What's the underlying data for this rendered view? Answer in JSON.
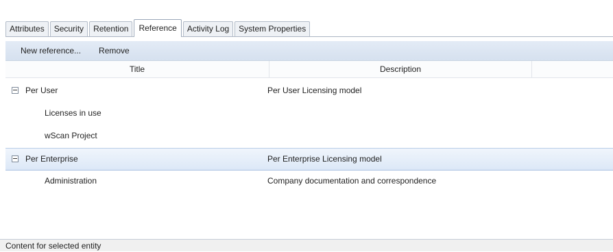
{
  "tabs": [
    {
      "label": "Attributes",
      "active": false
    },
    {
      "label": "Security",
      "active": false
    },
    {
      "label": "Retention",
      "active": false
    },
    {
      "label": "Reference",
      "active": true
    },
    {
      "label": "Activity Log",
      "active": false
    },
    {
      "label": "System Properties",
      "active": false
    }
  ],
  "toolbar": {
    "new_reference_label": "New reference...",
    "remove_label": "Remove"
  },
  "columns": {
    "title": "Title",
    "description": "Description"
  },
  "rows": [
    {
      "title": "Per User",
      "description": "Per User Licensing model",
      "level": 0,
      "expanded": true,
      "selected": false
    },
    {
      "title": "Licenses in use",
      "description": "",
      "level": 1,
      "selected": false
    },
    {
      "title": "wScan Project",
      "description": "",
      "level": 1,
      "selected": false
    },
    {
      "title": "Per Enterprise",
      "description": "Per Enterprise Licensing model",
      "level": 0,
      "expanded": true,
      "selected": true
    },
    {
      "title": "Administration",
      "description": "Company documentation and correspondence",
      "level": 1,
      "selected": false
    }
  ],
  "status_text": "Content for selected entity",
  "colors": {
    "selection": "#dce8f7",
    "toolbar": "#d6e1ef"
  },
  "icons": {
    "collapse": "collapse-toggle-icon"
  }
}
